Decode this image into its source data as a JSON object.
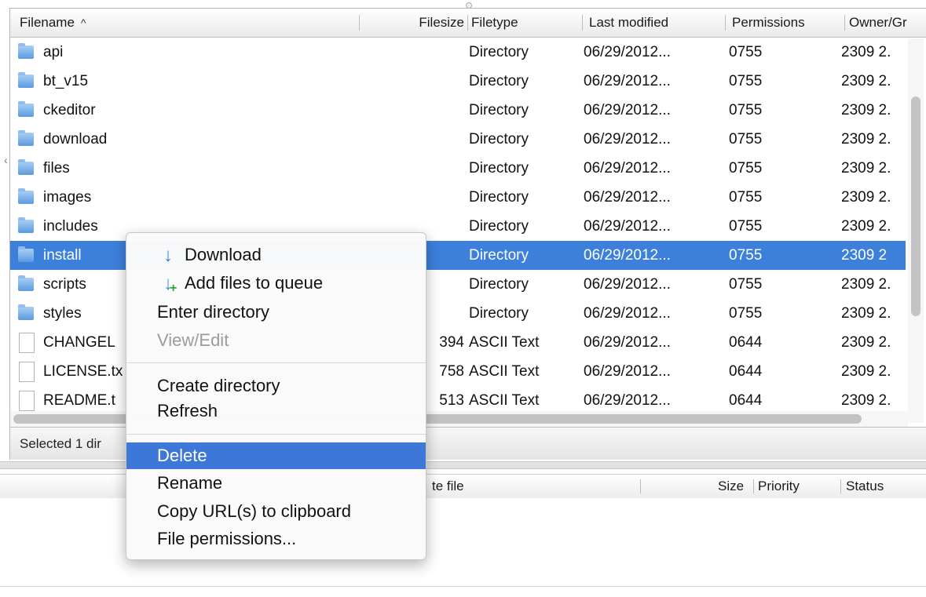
{
  "file_list": {
    "columns": {
      "filename": "Filename",
      "filesize": "Filesize",
      "filetype": "Filetype",
      "modified": "Last modified",
      "permissions": "Permissions",
      "owner": "Owner/Gr"
    },
    "sort_indicator": "^",
    "rows": [
      {
        "name": "api",
        "size": "",
        "type": "Directory",
        "modified": "06/29/2012...",
        "perms": "0755",
        "owner": "2309 2.",
        "icon": "folder-icon"
      },
      {
        "name": "bt_v15",
        "size": "",
        "type": "Directory",
        "modified": "06/29/2012...",
        "perms": "0755",
        "owner": "2309 2.",
        "icon": "folder-icon"
      },
      {
        "name": "ckeditor",
        "size": "",
        "type": "Directory",
        "modified": "06/29/2012...",
        "perms": "0755",
        "owner": "2309 2.",
        "icon": "folder-icon"
      },
      {
        "name": "download",
        "size": "",
        "type": "Directory",
        "modified": "06/29/2012...",
        "perms": "0755",
        "owner": "2309 2.",
        "icon": "folder-icon"
      },
      {
        "name": "files",
        "size": "",
        "type": "Directory",
        "modified": "06/29/2012...",
        "perms": "0755",
        "owner": "2309 2.",
        "icon": "folder-icon"
      },
      {
        "name": "images",
        "size": "",
        "type": "Directory",
        "modified": "06/29/2012...",
        "perms": "0755",
        "owner": "2309 2.",
        "icon": "folder-icon"
      },
      {
        "name": "includes",
        "size": "",
        "type": "Directory",
        "modified": "06/29/2012...",
        "perms": "0755",
        "owner": "2309 2.",
        "icon": "folder-icon"
      },
      {
        "name": "install",
        "size": "",
        "type": "Directory",
        "modified": "06/29/2012...",
        "perms": "0755",
        "owner": "2309 2",
        "icon": "folder-icon",
        "selected": true
      },
      {
        "name": "scripts",
        "size": "",
        "type": "Directory",
        "modified": "06/29/2012...",
        "perms": "0755",
        "owner": "2309 2.",
        "icon": "folder-icon"
      },
      {
        "name": "styles",
        "size": "",
        "type": "Directory",
        "modified": "06/29/2012...",
        "perms": "0755",
        "owner": "2309 2.",
        "icon": "folder-icon"
      },
      {
        "name": "CHANGEL",
        "size": "394",
        "type": "ASCII Text",
        "modified": "06/29/2012...",
        "perms": "0644",
        "owner": "2309 2.",
        "icon": "file-icon"
      },
      {
        "name": "LICENSE.tx",
        "size": "758",
        "type": "ASCII Text",
        "modified": "06/29/2012...",
        "perms": "0644",
        "owner": "2309 2.",
        "icon": "file-icon"
      },
      {
        "name": "README.t",
        "size": "513",
        "type": "ASCII Text",
        "modified": "06/29/2012...",
        "perms": "0644",
        "owner": "2309 2.",
        "icon": "file-icon"
      }
    ],
    "status_text": "Selected 1 dir"
  },
  "queue": {
    "columns": {
      "remote_file": "te file",
      "size": "Size",
      "priority": "Priority",
      "status": "Status"
    }
  },
  "context_menu": {
    "items": [
      {
        "label": "Download",
        "icon": "download-arrow-icon"
      },
      {
        "label": "Add files to queue",
        "icon": "add-to-queue-icon"
      },
      {
        "label": "Enter directory"
      },
      {
        "label": "View/Edit",
        "disabled": true
      },
      {
        "label": "Create directory"
      },
      {
        "label": "Refresh"
      },
      {
        "label": "Delete",
        "highlighted": true
      },
      {
        "label": "Rename"
      },
      {
        "label": "Copy URL(s) to clipboard"
      },
      {
        "label": "File permissions..."
      }
    ]
  },
  "colors": {
    "selection": "#3d80dc",
    "menu_highlight": "#3d78d9",
    "folder": "#5b9ae0"
  }
}
